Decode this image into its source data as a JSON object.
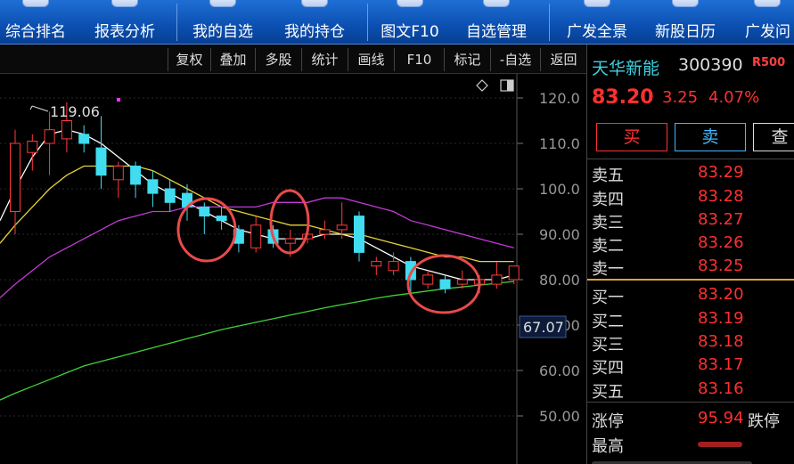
{
  "toolbar": {
    "items": [
      {
        "label": "综合排名",
        "icon": "ranking-icon"
      },
      {
        "label": "报表分析",
        "icon": "report-icon"
      },
      {
        "label": "我的自选",
        "icon": "watchlist-icon"
      },
      {
        "label": "我的持仓",
        "icon": "portfolio-icon"
      },
      {
        "label": "图文F10",
        "icon": "f10-icon"
      },
      {
        "label": "自选管理",
        "icon": "manage-icon"
      },
      {
        "label": "广发全景",
        "icon": "panorama-icon"
      },
      {
        "label": "新股日历",
        "icon": "calendar-icon"
      },
      {
        "label": "广发问",
        "icon": "ask-icon"
      }
    ]
  },
  "subbar": {
    "buttons": [
      "复权",
      "叠加",
      "多股",
      "统计",
      "画线",
      "F10",
      "标记",
      "-自选",
      "返回"
    ],
    "diamond_icon": "diamond-icon",
    "window_icon": "window-icon"
  },
  "chart_data": {
    "type": "candlestick",
    "y_ticks": [
      "120.0",
      "110.0",
      "100.0",
      "90.00",
      "80.00",
      "70.00",
      "60.00",
      "50.00"
    ],
    "ylim": [
      47.0,
      125.0
    ],
    "current_label": "67.07",
    "max_annotation": "119.06",
    "candles": [
      {
        "o": 95.0,
        "h": 113.0,
        "l": 90.0,
        "c": 110.0
      },
      {
        "o": 108.0,
        "h": 112.0,
        "l": 104.0,
        "c": 110.5
      },
      {
        "o": 110.0,
        "h": 117.0,
        "l": 103.0,
        "c": 113.0
      },
      {
        "o": 111.0,
        "h": 119.06,
        "l": 108.0,
        "c": 115.0
      },
      {
        "o": 112.0,
        "h": 114.0,
        "l": 108.0,
        "c": 110.0
      },
      {
        "o": 109.0,
        "h": 116.0,
        "l": 100.0,
        "c": 103.0
      },
      {
        "o": 102.0,
        "h": 106.0,
        "l": 98.0,
        "c": 105.0
      },
      {
        "o": 105.0,
        "h": 106.0,
        "l": 98.0,
        "c": 101.0
      },
      {
        "o": 102.0,
        "h": 104.0,
        "l": 96.0,
        "c": 99.0
      },
      {
        "o": 100.0,
        "h": 102.0,
        "l": 95.0,
        "c": 97.0
      },
      {
        "o": 99.0,
        "h": 101.0,
        "l": 93.0,
        "c": 96.0
      },
      {
        "o": 96.0,
        "h": 97.0,
        "l": 90.0,
        "c": 94.0
      },
      {
        "o": 94.0,
        "h": 96.0,
        "l": 91.0,
        "c": 93.0
      },
      {
        "o": 91.0,
        "h": 92.0,
        "l": 86.0,
        "c": 88.0
      },
      {
        "o": 87.0,
        "h": 94.0,
        "l": 86.0,
        "c": 92.0
      },
      {
        "o": 91.0,
        "h": 92.0,
        "l": 87.0,
        "c": 88.0
      },
      {
        "o": 88.0,
        "h": 91.0,
        "l": 85.0,
        "c": 89.0
      },
      {
        "o": 89.0,
        "h": 92.0,
        "l": 88.0,
        "c": 90.0
      },
      {
        "o": 90.0,
        "h": 93.0,
        "l": 89.0,
        "c": 91.0
      },
      {
        "o": 91.0,
        "h": 97.0,
        "l": 89.0,
        "c": 92.0
      },
      {
        "o": 94.0,
        "h": 95.0,
        "l": 84.0,
        "c": 86.0
      },
      {
        "o": 83.0,
        "h": 85.0,
        "l": 81.0,
        "c": 84.0
      },
      {
        "o": 82.0,
        "h": 86.0,
        "l": 81.0,
        "c": 84.0
      },
      {
        "o": 84.0,
        "h": 85.0,
        "l": 77.0,
        "c": 80.0
      },
      {
        "o": 79.0,
        "h": 82.0,
        "l": 78.0,
        "c": 81.0
      },
      {
        "o": 80.0,
        "h": 81.0,
        "l": 77.0,
        "c": 78.0
      },
      {
        "o": 79.0,
        "h": 82.0,
        "l": 78.0,
        "c": 80.0
      },
      {
        "o": 79.0,
        "h": 81.0,
        "l": 77.0,
        "c": 80.0
      },
      {
        "o": 79.0,
        "h": 84.0,
        "l": 78.0,
        "c": 81.0
      },
      {
        "o": 80.0,
        "h": 83.0,
        "l": 79.0,
        "c": 83.0
      }
    ],
    "ma_lines": [
      {
        "color": "#ffffff",
        "values": [
          100,
          107,
          112,
          113,
          112,
          110,
          107,
          104,
          101,
          99,
          97,
          95,
          93,
          91,
          90,
          89,
          89,
          89,
          90,
          90,
          89,
          87,
          85,
          83,
          82,
          81,
          80,
          80,
          80,
          81
        ]
      },
      {
        "color": "#e6d23a",
        "values": [
          92,
          96,
          100,
          103,
          105,
          105,
          105,
          105,
          104,
          102,
          100,
          98,
          96,
          95,
          94,
          93,
          92,
          92,
          91,
          90,
          90,
          89,
          88,
          87,
          86,
          85,
          85,
          84,
          84,
          84
        ]
      },
      {
        "color": "#c23ad6",
        "values": [
          79,
          82,
          85,
          87,
          89,
          91,
          93,
          94,
          95,
          95,
          96,
          96,
          96,
          96,
          96,
          97,
          97,
          97,
          98,
          98,
          97,
          96,
          95,
          93,
          92,
          91,
          90,
          89,
          88,
          87
        ]
      },
      {
        "color": "#3fd23a",
        "values": [
          55,
          56.5,
          58,
          59.5,
          61,
          62,
          63,
          64,
          65,
          66,
          67,
          68,
          69,
          69.8,
          70.6,
          71.4,
          72.2,
          73,
          73.8,
          74.5,
          75.2,
          75.9,
          76.5,
          77,
          77.5,
          78,
          78.4,
          78.8,
          79.2,
          79.6
        ]
      }
    ]
  },
  "panel": {
    "stock_name": "天华新能",
    "stock_code": "300390",
    "flag": "R500",
    "price": "83.20",
    "change": "3.25",
    "change_pct": "4.07%",
    "buy_label": "买",
    "sell_label": "卖",
    "query_label": "查",
    "asks": [
      {
        "label": "卖五",
        "price": "83.29"
      },
      {
        "label": "卖四",
        "price": "83.28"
      },
      {
        "label": "卖三",
        "price": "83.27"
      },
      {
        "label": "卖二",
        "price": "83.26"
      },
      {
        "label": "卖一",
        "price": "83.25"
      }
    ],
    "bids": [
      {
        "label": "买一",
        "price": "83.20"
      },
      {
        "label": "买二",
        "price": "83.19"
      },
      {
        "label": "买三",
        "price": "83.18"
      },
      {
        "label": "买四",
        "price": "83.17"
      },
      {
        "label": "买五",
        "price": "83.16"
      }
    ],
    "limit_up_label": "涨停",
    "limit_up_value": "95.94",
    "limit_down_label": "跌停",
    "high_label": "最高"
  }
}
